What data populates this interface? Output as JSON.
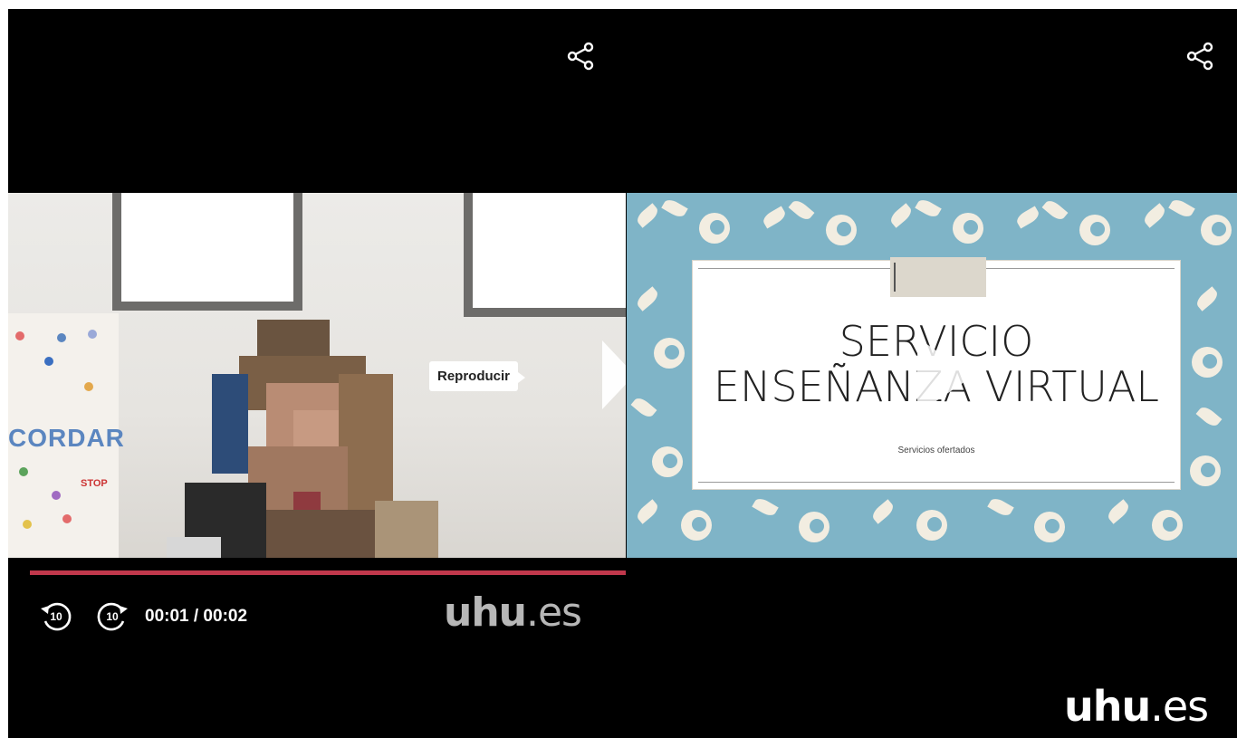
{
  "player": {
    "left_share_icon": "share-icon",
    "right_share_icon": "share-icon",
    "play_tooltip": "Reproducir",
    "slide": {
      "title_line1": "SERVICIO",
      "title_line2": "ENSEÑANZA VIRTUAL",
      "subtitle": "Servicios ofertados"
    },
    "controls": {
      "rewind_label": "10",
      "forward_label": "10",
      "time": "00:01 / 00:02",
      "progress_fraction": 1.0
    },
    "brand": {
      "logo_bold": "uhu",
      "logo_suffix": ".es"
    },
    "poster": {
      "word": "CORDAR",
      "stop": "STOP"
    }
  },
  "colors": {
    "background": "#000000",
    "progress_fill": "#c1384c",
    "slide_background": "#7fb4c7"
  }
}
